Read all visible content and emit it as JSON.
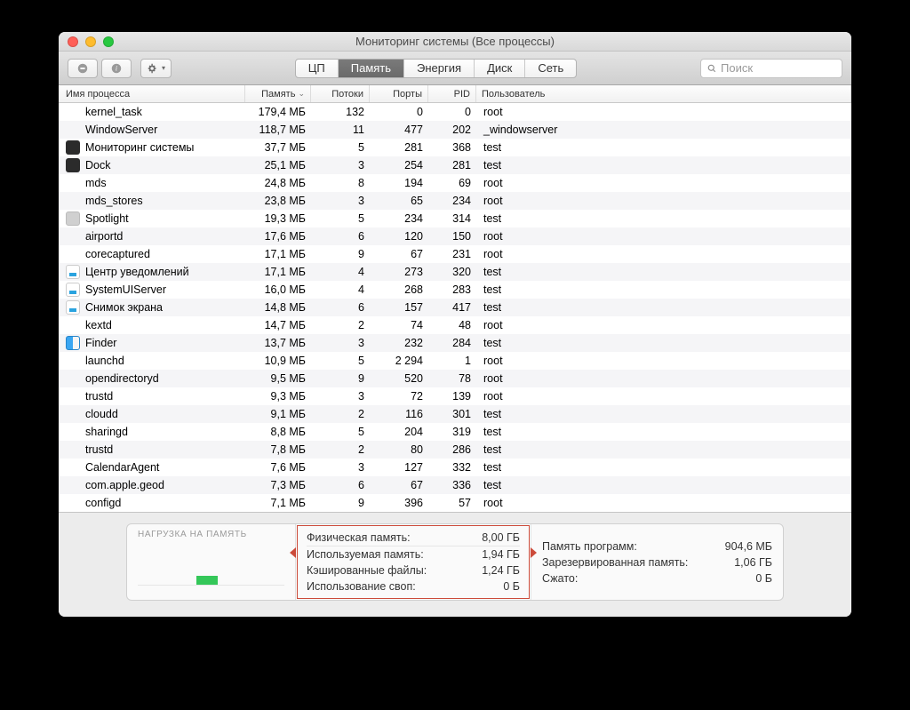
{
  "window": {
    "title": "Мониторинг системы (Все процессы)"
  },
  "tabs": {
    "cpu": "ЦП",
    "memory": "Память",
    "energy": "Энергия",
    "disk": "Диск",
    "network": "Сеть"
  },
  "search": {
    "placeholder": "Поиск"
  },
  "columns": {
    "name": "Имя процесса",
    "memory": "Память",
    "threads": "Потоки",
    "ports": "Порты",
    "pid": "PID",
    "user": "Пользователь"
  },
  "processes": [
    {
      "icon": "none",
      "name": "kernel_task",
      "mem": "179,4 МБ",
      "thr": "132",
      "ports": "0",
      "pid": "0",
      "user": "root"
    },
    {
      "icon": "none",
      "name": "WindowServer",
      "mem": "118,7 МБ",
      "thr": "11",
      "ports": "477",
      "pid": "202",
      "user": "_windowserver"
    },
    {
      "icon": "dark",
      "name": "Мониторинг системы",
      "mem": "37,7 МБ",
      "thr": "5",
      "ports": "281",
      "pid": "368",
      "user": "test"
    },
    {
      "icon": "dark",
      "name": "Dock",
      "mem": "25,1 МБ",
      "thr": "3",
      "ports": "254",
      "pid": "281",
      "user": "test"
    },
    {
      "icon": "none",
      "name": "mds",
      "mem": "24,8 МБ",
      "thr": "8",
      "ports": "194",
      "pid": "69",
      "user": "root"
    },
    {
      "icon": "none",
      "name": "mds_stores",
      "mem": "23,8 МБ",
      "thr": "3",
      "ports": "65",
      "pid": "234",
      "user": "root"
    },
    {
      "icon": "gray",
      "name": "Spotlight",
      "mem": "19,3 МБ",
      "thr": "5",
      "ports": "234",
      "pid": "314",
      "user": "test"
    },
    {
      "icon": "none",
      "name": "airportd",
      "mem": "17,6 МБ",
      "thr": "6",
      "ports": "120",
      "pid": "150",
      "user": "root"
    },
    {
      "icon": "none",
      "name": "corecaptured",
      "mem": "17,1 МБ",
      "thr": "9",
      "ports": "67",
      "pid": "231",
      "user": "root"
    },
    {
      "icon": "white",
      "name": "Центр уведомлений",
      "mem": "17,1 МБ",
      "thr": "4",
      "ports": "273",
      "pid": "320",
      "user": "test"
    },
    {
      "icon": "white",
      "name": "SystemUIServer",
      "mem": "16,0 МБ",
      "thr": "4",
      "ports": "268",
      "pid": "283",
      "user": "test"
    },
    {
      "icon": "white",
      "name": "Снимок экрана",
      "mem": "14,8 МБ",
      "thr": "6",
      "ports": "157",
      "pid": "417",
      "user": "test"
    },
    {
      "icon": "none",
      "name": "kextd",
      "mem": "14,7 МБ",
      "thr": "2",
      "ports": "74",
      "pid": "48",
      "user": "root"
    },
    {
      "icon": "finder",
      "name": "Finder",
      "mem": "13,7 МБ",
      "thr": "3",
      "ports": "232",
      "pid": "284",
      "user": "test"
    },
    {
      "icon": "none",
      "name": "launchd",
      "mem": "10,9 МБ",
      "thr": "5",
      "ports": "2 294",
      "pid": "1",
      "user": "root"
    },
    {
      "icon": "none",
      "name": "opendirectoryd",
      "mem": "9,5 МБ",
      "thr": "9",
      "ports": "520",
      "pid": "78",
      "user": "root"
    },
    {
      "icon": "none",
      "name": "trustd",
      "mem": "9,3 МБ",
      "thr": "3",
      "ports": "72",
      "pid": "139",
      "user": "root"
    },
    {
      "icon": "none",
      "name": "cloudd",
      "mem": "9,1 МБ",
      "thr": "2",
      "ports": "116",
      "pid": "301",
      "user": "test"
    },
    {
      "icon": "none",
      "name": "sharingd",
      "mem": "8,8 МБ",
      "thr": "5",
      "ports": "204",
      "pid": "319",
      "user": "test"
    },
    {
      "icon": "none",
      "name": "trustd",
      "mem": "7,8 МБ",
      "thr": "2",
      "ports": "80",
      "pid": "286",
      "user": "test"
    },
    {
      "icon": "none",
      "name": "CalendarAgent",
      "mem": "7,6 МБ",
      "thr": "3",
      "ports": "127",
      "pid": "332",
      "user": "test"
    },
    {
      "icon": "none",
      "name": "com.apple.geod",
      "mem": "7,3 МБ",
      "thr": "6",
      "ports": "67",
      "pid": "336",
      "user": "test"
    },
    {
      "icon": "none",
      "name": "configd",
      "mem": "7,1 МБ",
      "thr": "9",
      "ports": "396",
      "pid": "57",
      "user": "root"
    }
  ],
  "summary": {
    "pressure_title": "НАГРУЗКА НА ПАМЯТЬ",
    "mid": {
      "phys_l": "Физическая память:",
      "phys_v": "8,00 ГБ",
      "used_l": "Используемая память:",
      "used_v": "1,94 ГБ",
      "cache_l": "Кэшированные файлы:",
      "cache_v": "1,24 ГБ",
      "swap_l": "Использование своп:",
      "swap_v": "0 Б"
    },
    "right": {
      "app_l": "Память программ:",
      "app_v": "904,6 МБ",
      "wired_l": "Зарезервированная память:",
      "wired_v": "1,06 ГБ",
      "comp_l": "Сжато:",
      "comp_v": "0 Б"
    }
  }
}
